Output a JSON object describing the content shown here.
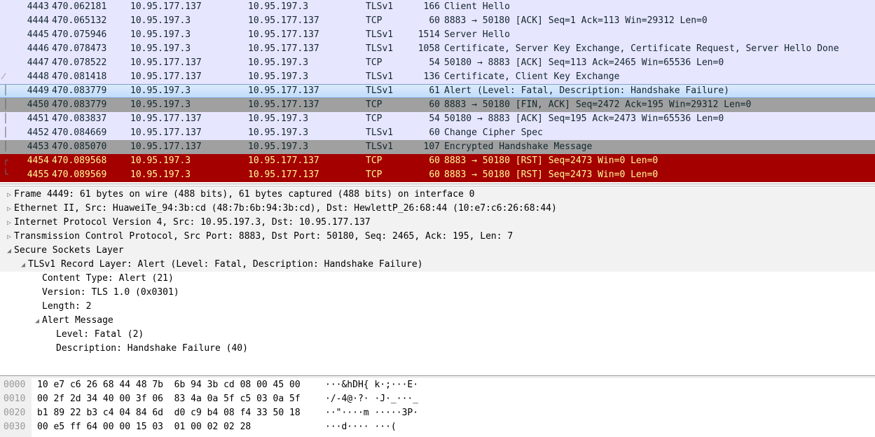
{
  "packets": [
    {
      "no": "4443",
      "time": "470.062181",
      "src": "10.95.177.137",
      "dst": "10.95.197.3",
      "proto": "TLSv1",
      "len": "166",
      "info": "Client Hello",
      "style": ""
    },
    {
      "no": "4444",
      "time": "470.065132",
      "src": "10.95.197.3",
      "dst": "10.95.177.137",
      "proto": "TCP",
      "len": "60",
      "info": "8883 → 50180 [ACK] Seq=1 Ack=113 Win=29312 Len=0",
      "style": ""
    },
    {
      "no": "4445",
      "time": "470.075946",
      "src": "10.95.197.3",
      "dst": "10.95.177.137",
      "proto": "TLSv1",
      "len": "1514",
      "info": "Server Hello",
      "style": ""
    },
    {
      "no": "4446",
      "time": "470.078473",
      "src": "10.95.197.3",
      "dst": "10.95.177.137",
      "proto": "TLSv1",
      "len": "1058",
      "info": "Certificate, Server Key Exchange, Certificate Request, Server Hello Done",
      "style": ""
    },
    {
      "no": "4447",
      "time": "470.078522",
      "src": "10.95.177.137",
      "dst": "10.95.197.3",
      "proto": "TCP",
      "len": "54",
      "info": "50180 → 8883 [ACK] Seq=113 Ack=2465 Win=65536 Len=0",
      "style": ""
    },
    {
      "no": "4448",
      "time": "470.081418",
      "src": "10.95.177.137",
      "dst": "10.95.197.3",
      "proto": "TLSv1",
      "len": "136",
      "info": "Certificate, Client Key Exchange",
      "style": ""
    },
    {
      "no": "4449",
      "time": "470.083779",
      "src": "10.95.197.3",
      "dst": "10.95.177.137",
      "proto": "TLSv1",
      "len": "61",
      "info": "Alert (Level: Fatal, Description: Handshake Failure)",
      "style": "sel"
    },
    {
      "no": "4450",
      "time": "470.083779",
      "src": "10.95.197.3",
      "dst": "10.95.177.137",
      "proto": "TCP",
      "len": "60",
      "info": "8883 → 50180 [FIN, ACK] Seq=2472 Ack=195 Win=29312 Len=0",
      "style": "gray"
    },
    {
      "no": "4451",
      "time": "470.083837",
      "src": "10.95.177.137",
      "dst": "10.95.197.3",
      "proto": "TCP",
      "len": "54",
      "info": "50180 → 8883 [ACK] Seq=195 Ack=2473 Win=65536 Len=0",
      "style": ""
    },
    {
      "no": "4452",
      "time": "470.084669",
      "src": "10.95.177.137",
      "dst": "10.95.197.3",
      "proto": "TLSv1",
      "len": "60",
      "info": "Change Cipher Spec",
      "style": ""
    },
    {
      "no": "4453",
      "time": "470.085070",
      "src": "10.95.177.137",
      "dst": "10.95.197.3",
      "proto": "TLSv1",
      "len": "107",
      "info": "Encrypted Handshake Message",
      "style": "gray"
    },
    {
      "no": "4454",
      "time": "470.089568",
      "src": "10.95.197.3",
      "dst": "10.95.177.137",
      "proto": "TCP",
      "len": "60",
      "info": "8883 → 50180 [RST] Seq=2473 Win=0 Len=0",
      "style": "red"
    },
    {
      "no": "4455",
      "time": "470.089569",
      "src": "10.95.197.3",
      "dst": "10.95.177.137",
      "proto": "TCP",
      "len": "60",
      "info": "8883 → 50180 [RST] Seq=2473 Win=0 Len=0",
      "style": "red"
    }
  ],
  "details": [
    {
      "text": "Frame 4449: 61 bytes on wire (488 bits), 61 bytes captured (488 bits) on interface 0",
      "level": 0,
      "state": "collapsed",
      "header": true
    },
    {
      "text": "Ethernet II, Src: HuaweiTe_94:3b:cd (48:7b:6b:94:3b:cd), Dst: HewlettP_26:68:44 (10:e7:c6:26:68:44)",
      "level": 0,
      "state": "collapsed",
      "header": true
    },
    {
      "text": "Internet Protocol Version 4, Src: 10.95.197.3, Dst: 10.95.177.137",
      "level": 0,
      "state": "collapsed",
      "header": true
    },
    {
      "text": "Transmission Control Protocol, Src Port: 8883, Dst Port: 50180, Seq: 2465, Ack: 195, Len: 7",
      "level": 0,
      "state": "collapsed",
      "header": true
    },
    {
      "text": "Secure Sockets Layer",
      "level": 0,
      "state": "expanded",
      "header": true
    },
    {
      "text": "TLSv1 Record Layer: Alert (Level: Fatal, Description: Handshake Failure)",
      "level": 1,
      "state": "expanded",
      "header": true
    },
    {
      "text": "Content Type: Alert (21)",
      "level": 2,
      "state": "leaf",
      "header": false
    },
    {
      "text": "Version: TLS 1.0 (0x0301)",
      "level": 2,
      "state": "leaf",
      "header": false
    },
    {
      "text": "Length: 2",
      "level": 2,
      "state": "leaf",
      "header": false
    },
    {
      "text": "Alert Message",
      "level": 2,
      "state": "expanded",
      "header": false
    },
    {
      "text": "Level: Fatal (2)",
      "level": 3,
      "state": "leaf",
      "header": false
    },
    {
      "text": "Description: Handshake Failure (40)",
      "level": 3,
      "state": "leaf",
      "header": false
    }
  ],
  "hex": [
    {
      "offset": "0000",
      "bytes": "10 e7 c6 26 68 44 48 7b  6b 94 3b cd 08 00 45 00",
      "ascii": "···&hDH{ k·;···E·"
    },
    {
      "offset": "0010",
      "bytes": "00 2f 2d 34 40 00 3f 06  83 4a 0a 5f c5 03 0a 5f",
      "ascii": "·/-4@·?· ·J·_···_"
    },
    {
      "offset": "0020",
      "bytes": "b1 89 22 b3 c4 04 84 6d  d0 c9 b4 08 f4 33 50 18",
      "ascii": "··\"····m ·····3P·"
    },
    {
      "offset": "0030",
      "bytes": "00 e5 ff 64 00 00 15 03  01 00 02 02 28",
      "ascii": "···d···· ···("
    }
  ],
  "colors": {
    "default_row": "#e7e6ff",
    "bad_tcp_row": "#a40000",
    "bad_tcp_text": "#fffc9c",
    "gray_row": "#a0a0a0",
    "selected_row": "#c1dcfb"
  },
  "icons": {
    "collapsed": "triangle-right-icon",
    "expanded": "triangle-down-icon"
  }
}
